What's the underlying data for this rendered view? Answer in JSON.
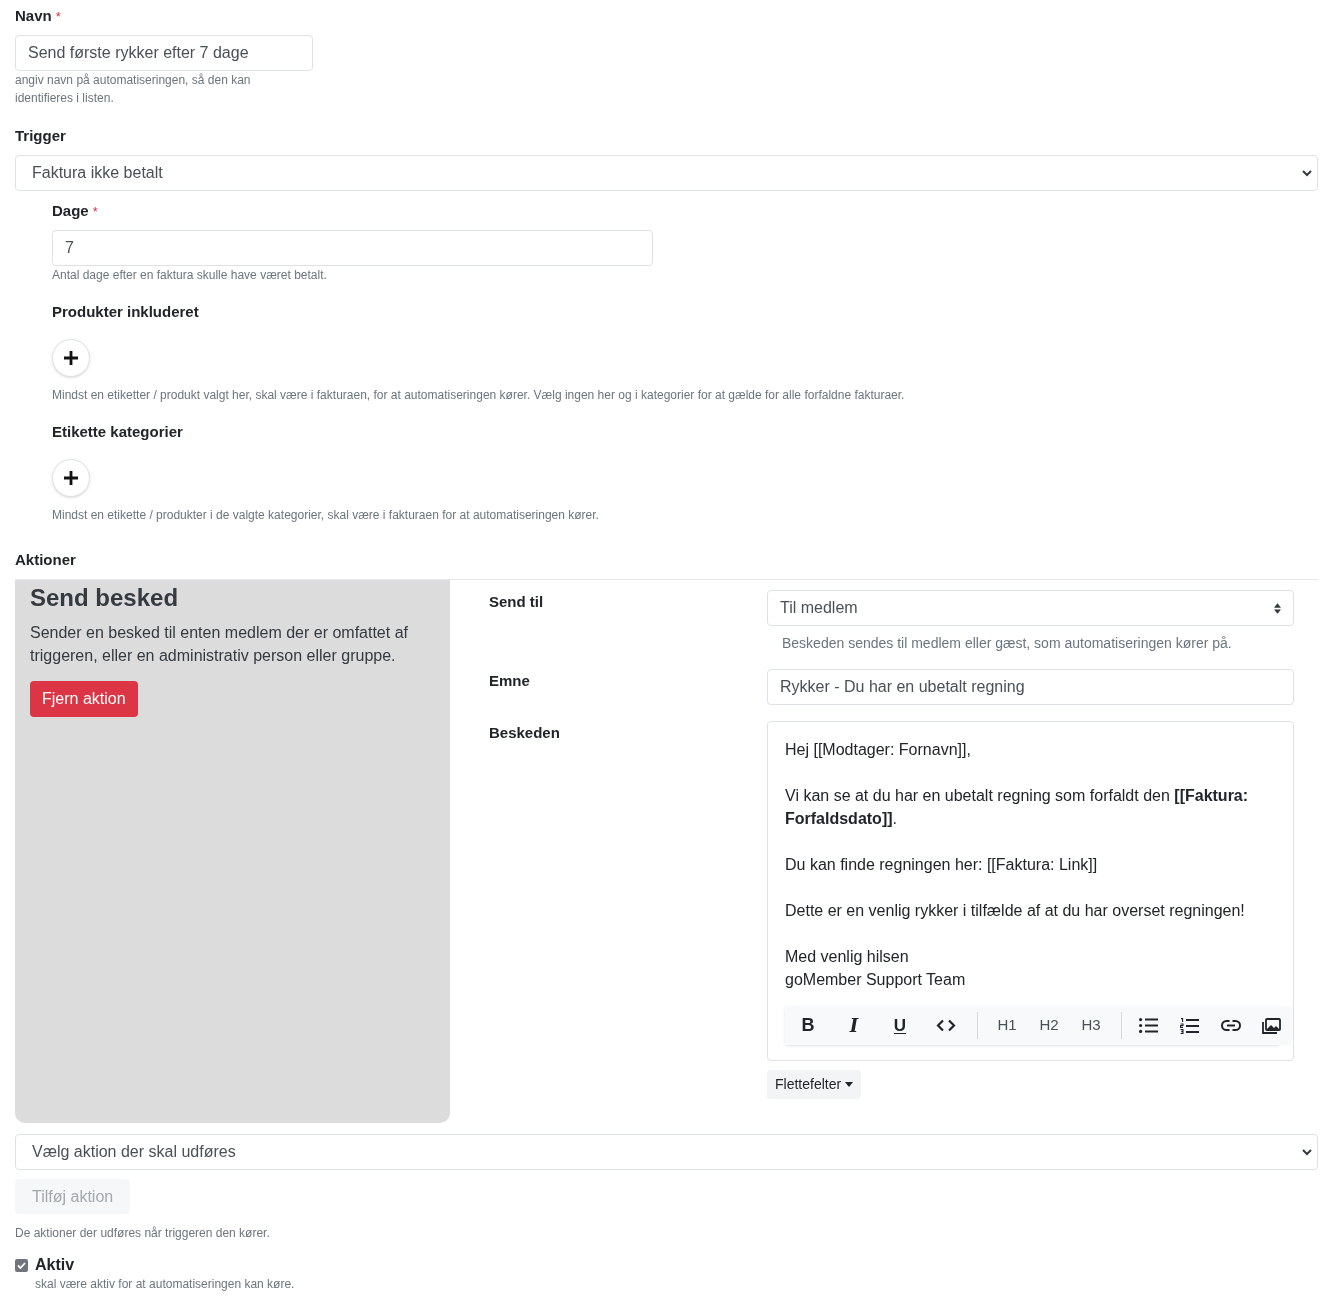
{
  "name_field": {
    "label": "Navn",
    "required_mark": "*",
    "value": "Send første rykker efter 7 dage",
    "help": "angiv navn på automatiseringen, så den kan identifieres i listen."
  },
  "trigger": {
    "label": "Trigger",
    "value": "Faktura ikke betalt",
    "settings": [
      {
        "kind": "number",
        "label": "Dage",
        "required_mark": "*",
        "value": "7",
        "help": "Antal dage efter en faktura skulle have været betalt."
      },
      {
        "kind": "picker",
        "label": "Produkter inkluderet",
        "help": "Mindst en etiketter / produkt valgt her, skal være i fakturaen, for at automatiseringen kører. Vælg ingen her og i kategorier for at gælde for alle forfaldne fakturaer."
      },
      {
        "kind": "picker",
        "label": "Etikette kategorier",
        "help": "Mindst en etikette / produkter i de valgte kategorier, skal være i fakturaen for at automatiseringen kører."
      }
    ]
  },
  "actions": {
    "label": "Aktioner",
    "items": [
      {
        "title": "Send besked",
        "description": "Sender en besked til enten medlem der er omfattet af triggeren, eller en administrativ person eller gruppe.",
        "remove_button": "Fjern aktion",
        "fields": [
          {
            "kind": "select",
            "label": "Send til",
            "value": "Til medlem",
            "help": "Beskeden sendes til medlem eller gæst, som automatiseringen kører på."
          },
          {
            "kind": "text",
            "label": "Emne",
            "value": "Rykker - Du har en ubetalt regning"
          },
          {
            "kind": "editor",
            "label": "Beskeden",
            "paragraphs": [
              [
                "Hej [[Modtager: Fornavn]],"
              ],
              [
                "Vi kan se at du har en ubetalt regning som forfaldt den **[[Faktura: Forfaldsdato]]**."
              ],
              [
                "Du kan finde regningen her: [[Faktura: Link]]"
              ],
              [
                "Dette er en venlig rykker i tilfælde af at du har overset regningen!"
              ],
              [
                "Med venlig hilsen",
                "goMember Support Team"
              ]
            ],
            "toolbar": [
              [
                {
                  "kind": "bold",
                  "glyph": "B"
                },
                {
                  "kind": "italic",
                  "glyph": "I"
                },
                {
                  "kind": "underline",
                  "glyph": "U"
                },
                {
                  "kind": "code"
                }
              ],
              [
                {
                  "kind": "heading",
                  "glyph": "H1"
                },
                {
                  "kind": "heading",
                  "glyph": "H2"
                },
                {
                  "kind": "heading",
                  "glyph": "H3"
                }
              ],
              [
                {
                  "kind": "bullet_list"
                },
                {
                  "kind": "numbered_list"
                },
                {
                  "kind": "link"
                },
                {
                  "kind": "image"
                }
              ]
            ],
            "merge_button": "Flettefelter"
          }
        ]
      }
    ],
    "picker": {
      "value": "Vælg aktion der skal udføres"
    },
    "add_button": {
      "label": "Tilføj aktion",
      "disabled": true
    },
    "help": "De aktioner der udføres når triggeren den kører."
  },
  "active": {
    "label": "Aktiv",
    "checked": true,
    "help": "skal være aktiv for at automatiseringen kan køre."
  }
}
